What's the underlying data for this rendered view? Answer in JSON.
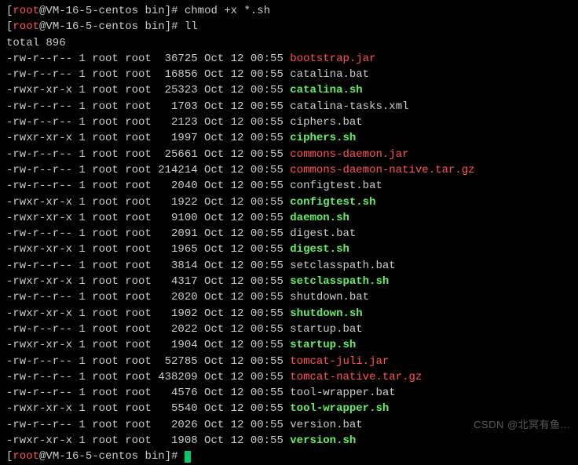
{
  "prompt": {
    "user": "root",
    "host": "VM-16-5-centos",
    "path": "bin",
    "symbol": "#"
  },
  "commands": {
    "cmd1": "chmod +x *.sh",
    "cmd2": "ll"
  },
  "total_line": "total 896",
  "files": [
    {
      "perm": "-rw-r--r--",
      "links": "1",
      "owner": "root",
      "group": "root",
      "size": "36725",
      "date": "Oct 12 00:55",
      "name": "bootstrap.jar",
      "type": "jar"
    },
    {
      "perm": "-rw-r--r--",
      "links": "1",
      "owner": "root",
      "group": "root",
      "size": "16856",
      "date": "Oct 12 00:55",
      "name": "catalina.bat",
      "type": "bat"
    },
    {
      "perm": "-rwxr-xr-x",
      "links": "1",
      "owner": "root",
      "group": "root",
      "size": "25323",
      "date": "Oct 12 00:55",
      "name": "catalina.sh",
      "type": "sh"
    },
    {
      "perm": "-rw-r--r--",
      "links": "1",
      "owner": "root",
      "group": "root",
      "size": "1703",
      "date": "Oct 12 00:55",
      "name": "catalina-tasks.xml",
      "type": "xml"
    },
    {
      "perm": "-rw-r--r--",
      "links": "1",
      "owner": "root",
      "group": "root",
      "size": "2123",
      "date": "Oct 12 00:55",
      "name": "ciphers.bat",
      "type": "bat"
    },
    {
      "perm": "-rwxr-xr-x",
      "links": "1",
      "owner": "root",
      "group": "root",
      "size": "1997",
      "date": "Oct 12 00:55",
      "name": "ciphers.sh",
      "type": "sh"
    },
    {
      "perm": "-rw-r--r--",
      "links": "1",
      "owner": "root",
      "group": "root",
      "size": "25661",
      "date": "Oct 12 00:55",
      "name": "commons-daemon.jar",
      "type": "jar"
    },
    {
      "perm": "-rw-r--r--",
      "links": "1",
      "owner": "root",
      "group": "root",
      "size": "214214",
      "date": "Oct 12 00:55",
      "name": "commons-daemon-native.tar.gz",
      "type": "tgz"
    },
    {
      "perm": "-rw-r--r--",
      "links": "1",
      "owner": "root",
      "group": "root",
      "size": "2040",
      "date": "Oct 12 00:55",
      "name": "configtest.bat",
      "type": "bat"
    },
    {
      "perm": "-rwxr-xr-x",
      "links": "1",
      "owner": "root",
      "group": "root",
      "size": "1922",
      "date": "Oct 12 00:55",
      "name": "configtest.sh",
      "type": "sh"
    },
    {
      "perm": "-rwxr-xr-x",
      "links": "1",
      "owner": "root",
      "group": "root",
      "size": "9100",
      "date": "Oct 12 00:55",
      "name": "daemon.sh",
      "type": "sh"
    },
    {
      "perm": "-rw-r--r--",
      "links": "1",
      "owner": "root",
      "group": "root",
      "size": "2091",
      "date": "Oct 12 00:55",
      "name": "digest.bat",
      "type": "bat"
    },
    {
      "perm": "-rwxr-xr-x",
      "links": "1",
      "owner": "root",
      "group": "root",
      "size": "1965",
      "date": "Oct 12 00:55",
      "name": "digest.sh",
      "type": "sh"
    },
    {
      "perm": "-rw-r--r--",
      "links": "1",
      "owner": "root",
      "group": "root",
      "size": "3814",
      "date": "Oct 12 00:55",
      "name": "setclasspath.bat",
      "type": "bat"
    },
    {
      "perm": "-rwxr-xr-x",
      "links": "1",
      "owner": "root",
      "group": "root",
      "size": "4317",
      "date": "Oct 12 00:55",
      "name": "setclasspath.sh",
      "type": "sh"
    },
    {
      "perm": "-rw-r--r--",
      "links": "1",
      "owner": "root",
      "group": "root",
      "size": "2020",
      "date": "Oct 12 00:55",
      "name": "shutdown.bat",
      "type": "bat"
    },
    {
      "perm": "-rwxr-xr-x",
      "links": "1",
      "owner": "root",
      "group": "root",
      "size": "1902",
      "date": "Oct 12 00:55",
      "name": "shutdown.sh",
      "type": "sh"
    },
    {
      "perm": "-rw-r--r--",
      "links": "1",
      "owner": "root",
      "group": "root",
      "size": "2022",
      "date": "Oct 12 00:55",
      "name": "startup.bat",
      "type": "bat"
    },
    {
      "perm": "-rwxr-xr-x",
      "links": "1",
      "owner": "root",
      "group": "root",
      "size": "1904",
      "date": "Oct 12 00:55",
      "name": "startup.sh",
      "type": "sh"
    },
    {
      "perm": "-rw-r--r--",
      "links": "1",
      "owner": "root",
      "group": "root",
      "size": "52785",
      "date": "Oct 12 00:55",
      "name": "tomcat-juli.jar",
      "type": "jar"
    },
    {
      "perm": "-rw-r--r--",
      "links": "1",
      "owner": "root",
      "group": "root",
      "size": "438209",
      "date": "Oct 12 00:55",
      "name": "tomcat-native.tar.gz",
      "type": "tgz"
    },
    {
      "perm": "-rw-r--r--",
      "links": "1",
      "owner": "root",
      "group": "root",
      "size": "4576",
      "date": "Oct 12 00:55",
      "name": "tool-wrapper.bat",
      "type": "bat"
    },
    {
      "perm": "-rwxr-xr-x",
      "links": "1",
      "owner": "root",
      "group": "root",
      "size": "5540",
      "date": "Oct 12 00:55",
      "name": "tool-wrapper.sh",
      "type": "sh"
    },
    {
      "perm": "-rw-r--r--",
      "links": "1",
      "owner": "root",
      "group": "root",
      "size": "2026",
      "date": "Oct 12 00:55",
      "name": "version.bat",
      "type": "bat"
    },
    {
      "perm": "-rwxr-xr-x",
      "links": "1",
      "owner": "root",
      "group": "root",
      "size": "1908",
      "date": "Oct 12 00:55",
      "name": "version.sh",
      "type": "sh"
    }
  ],
  "watermark": "CSDN @北冥有鱼..."
}
